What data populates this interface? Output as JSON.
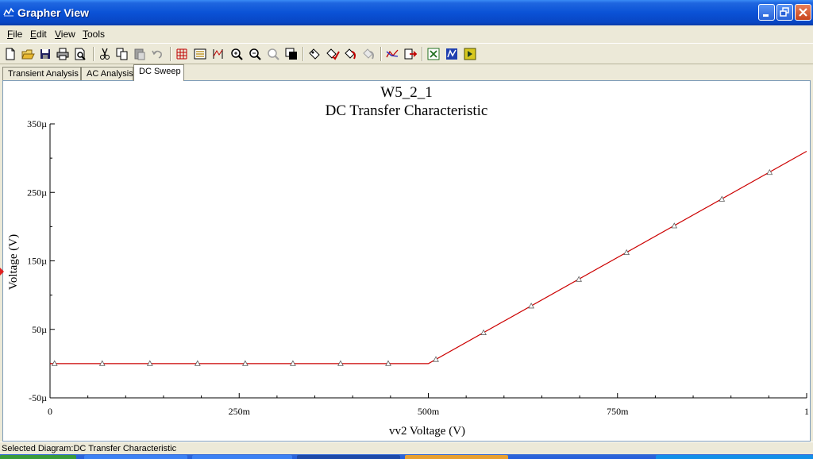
{
  "window": {
    "title": "Grapher View"
  },
  "menu": [
    {
      "key": "F",
      "rest": "ile"
    },
    {
      "key": "E",
      "rest": "dit"
    },
    {
      "key": "V",
      "rest": "iew"
    },
    {
      "key": "T",
      "rest": "ools"
    }
  ],
  "toolbar_icons": [
    "new-icon",
    "open-icon",
    "save-icon",
    "print-icon",
    "print-preview-icon",
    "cut-icon",
    "copy-icon",
    "paste-icon",
    "undo-icon",
    "grid-icon",
    "legend-icon",
    "cursors-icon",
    "zoom-in-icon",
    "zoom-out-icon",
    "zoom-full-icon",
    "reverse-colors-icon",
    "properties-icon",
    "overlay-traces-icon",
    "add-trace-icon",
    "remove-trace-icon",
    "show-markers-icon",
    "export-icon",
    "export-excel-icon",
    "export-mathcad-icon",
    "export-labview-icon"
  ],
  "tabs": [
    {
      "label": "Transient Analysis",
      "active": false
    },
    {
      "label": "AC Analysis",
      "active": false
    },
    {
      "label": "DC Sweep",
      "active": true
    }
  ],
  "status": {
    "text": "Selected Diagram:DC Transfer Characteristic"
  },
  "colors": {
    "trace": "#cc0000",
    "title_bar": "#0a52d6"
  },
  "chart_data": {
    "type": "line",
    "title": "W5_2_1",
    "subtitle": "DC Transfer Characteristic",
    "xlabel": "vv2 Voltage (V)",
    "ylabel": "Voltage (V)",
    "xlim": [
      0,
      1
    ],
    "ylim": [
      -5e-05,
      0.00035
    ],
    "x_ticks": [
      {
        "value": 0,
        "label": "0"
      },
      {
        "value": 0.25,
        "label": "250m"
      },
      {
        "value": 0.5,
        "label": "500m"
      },
      {
        "value": 0.75,
        "label": "750m"
      },
      {
        "value": 1,
        "label": "1"
      }
    ],
    "y_ticks": [
      {
        "value": -5e-05,
        "label": "-50µ"
      },
      {
        "value": 5e-05,
        "label": "50µ"
      },
      {
        "value": 0.00015,
        "label": "150µ"
      },
      {
        "value": 0.00025,
        "label": "250µ"
      },
      {
        "value": 0.00035,
        "label": "350µ"
      }
    ],
    "grid": false,
    "series": [
      {
        "line": [
          [
            0,
            0
          ],
          [
            0.5,
            0
          ],
          [
            1,
            0.00031
          ]
        ],
        "markers": [
          [
            0.006,
            0
          ],
          [
            0.069,
            0
          ],
          [
            0.132,
            0
          ],
          [
            0.195,
            0
          ],
          [
            0.258,
            0
          ],
          [
            0.321,
            0
          ],
          [
            0.384,
            0
          ],
          [
            0.447,
            0
          ],
          [
            0.51,
            6e-06
          ],
          [
            0.573,
            4.5e-05
          ],
          [
            0.636,
            8.4e-05
          ],
          [
            0.699,
            0.000123
          ],
          [
            0.762,
            0.000162
          ],
          [
            0.825,
            0.000201
          ],
          [
            0.888,
            0.00024
          ],
          [
            0.951,
            0.000279
          ]
        ]
      }
    ]
  }
}
